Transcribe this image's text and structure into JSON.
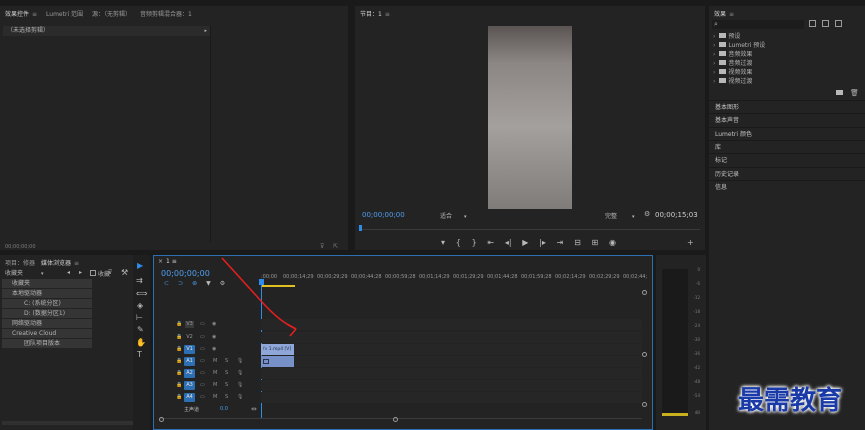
{
  "effect_controls": {
    "tabs": [
      "效果控件",
      "Lumetri 范围",
      "源：（无剪辑）",
      "音频剪辑混合器：1"
    ],
    "menu_glyph": "≡",
    "no_clip": "（未选择剪辑）",
    "timecode": "00;00;00;00"
  },
  "program": {
    "title": "节目：1",
    "menu_glyph": "≡",
    "timecode": "00;00;00;00",
    "fit": "适合",
    "quality": "完整",
    "duration": "00;00;15;03"
  },
  "effects_panel": {
    "title": "效果",
    "menu_glyph": "≡",
    "folders": [
      "预设",
      "Lumetri 预设",
      "音频效果",
      "音频过渡",
      "视频效果",
      "视频过渡"
    ],
    "sections": [
      "基本图形",
      "基本声音",
      "Lumetri 颜色",
      "库",
      "标记",
      "历史记录",
      "信息"
    ]
  },
  "media_browser": {
    "tabs": [
      "项目：修器",
      "媒体浏览器"
    ],
    "menu_glyph": "≡",
    "favorites": "收藏夹",
    "tree": [
      {
        "label": "收藏夹",
        "indent": 0
      },
      {
        "label": "本地驱动器",
        "indent": 0
      },
      {
        "label": "C: (系统分区)",
        "indent": 1
      },
      {
        "label": "D: (数据分区1)",
        "indent": 1
      },
      {
        "label": "网络驱动器",
        "indent": 0
      },
      {
        "label": "Creative Cloud",
        "indent": 0
      },
      {
        "label": "团队项目版本",
        "indent": 1
      }
    ],
    "label_favorite": "收藏"
  },
  "timeline": {
    "tab": "1",
    "menu_glyph": "≡",
    "timecode": "00;00;00;00",
    "ruler": [
      ":00;00",
      "00;00;14;29",
      "00;00;29;29",
      "00;00;44;28",
      "00;00;59;28",
      "00;01;14;29",
      "00;01;29;29",
      "00;01;44;28",
      "00;01;59;28",
      "00;02;14;29",
      "00;02;29;29",
      "00;02;44;"
    ],
    "tracks": [
      "V3",
      "V2",
      "V1",
      "A1",
      "A2",
      "A3",
      "A4"
    ],
    "master_label": "主声道",
    "master_value": "0.0",
    "clip_label": "1.mp4 [V]",
    "clip_icon": "fx",
    "m": "M",
    "s": "S"
  },
  "meters": {
    "scale": [
      "0",
      "-6",
      "-12",
      "-18",
      "-24",
      "-30",
      "-36",
      "-42",
      "-48",
      "-54",
      "dB"
    ]
  },
  "watermark": "最需教育",
  "colors": {
    "accent": "#2d8ceb",
    "clip": "#8fa7d8",
    "audio_clip": "#7890c8",
    "red_arrow": "#e02020"
  }
}
